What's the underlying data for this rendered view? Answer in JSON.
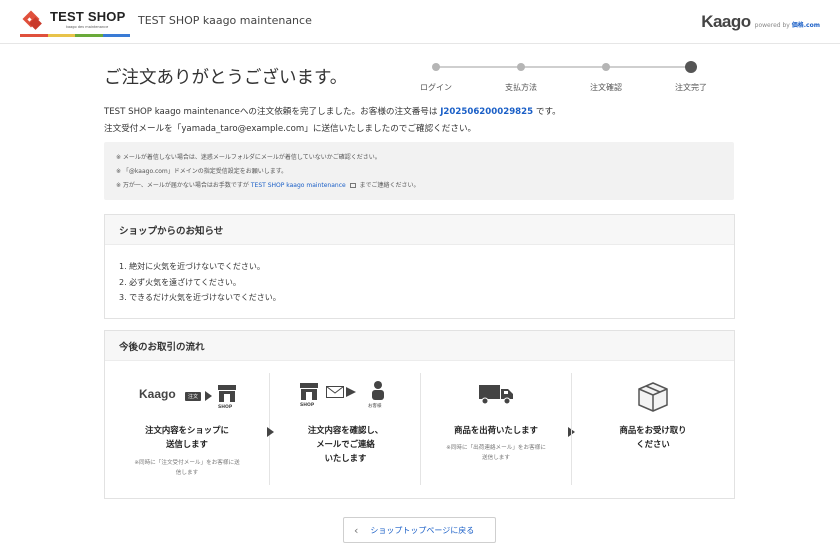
{
  "header": {
    "logo_text": "TEST SHOP",
    "logo_sub": "kaago dev maintenance",
    "shop_name": "TEST SHOP kaago maintenance",
    "brand": "Kaago",
    "powered_by": "powered by",
    "powered_brand": "価格.com",
    "logo_colors": [
      "#e0503c",
      "#e8c34a",
      "#6aaa3a",
      "#3a7bd5"
    ]
  },
  "title": "ご注文ありがとうございます。",
  "steps": [
    {
      "label": "ログイン",
      "active": false
    },
    {
      "label": "支払方法",
      "active": false
    },
    {
      "label": "注文確認",
      "active": false
    },
    {
      "label": "注文完了",
      "active": true
    }
  ],
  "message": {
    "line1_before": "TEST SHOP kaago maintenanceへの注文依頼を完了しました。お客様の注文番号は",
    "order_number": "J202506200029825",
    "line1_after": "です。",
    "line2": "注文受付メールを「yamada_taro@example.com」に送信いたしましたのでご確認ください。"
  },
  "notice": {
    "line1": "※ メールが着信しない場合は、迷惑メールフォルダにメールが着信していないかご確認ください。",
    "line2": "※ 「@kaago.com」ドメインの指定受信設定をお願いします。",
    "line3_before": "※ 万が一、メールが届かない場合はお手数ですが",
    "line3_link": "TEST SHOP kaago maintenance",
    "line3_after": "までご連絡ください。"
  },
  "news": {
    "heading": "ショップからのお知らせ",
    "items": [
      "1. 絶対に火気を近づけないでください。",
      "2. 必ず火気を遠ざけてください。",
      "3. できるだけ火気を近づけないでください。"
    ]
  },
  "flow": {
    "heading": "今後のお取引の流れ",
    "step1": {
      "icon_brand": "Kaago",
      "icon_chip": "注文",
      "icon_shop": "SHOP",
      "title_l1": "注文内容をショップに",
      "title_l2": "送信します",
      "sub_l1": "※同時に「注文受付メール」をお客様に送",
      "sub_l2": "信します"
    },
    "step2": {
      "icon_shop": "SHOP",
      "icon_customer": "お客様",
      "title_l1": "注文内容を確認し、",
      "title_l2": "メールでご連絡",
      "title_l3": "いたします"
    },
    "step3": {
      "title": "商品を出荷いたします",
      "sub_l1": "※同時に「出荷連絡メール」をお客様に",
      "sub_l2": "送信します"
    },
    "step4": {
      "title_l1": "商品をお受け取り",
      "title_l2": "ください"
    }
  },
  "back_button": {
    "label": "ショップトップページに戻る"
  }
}
